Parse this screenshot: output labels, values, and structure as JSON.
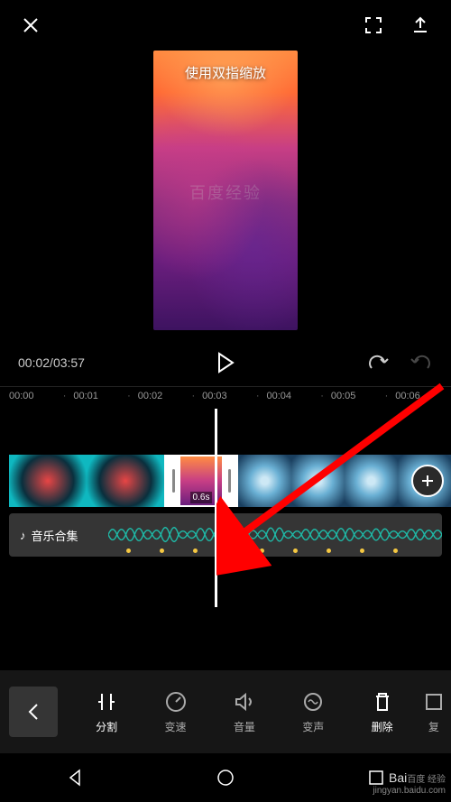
{
  "preview": {
    "hint": "使用双指缩放"
  },
  "playback": {
    "current_time": "00:02",
    "total_time": "03:57"
  },
  "ruler": {
    "marks": [
      "00:00",
      "00:01",
      "00:02",
      "00:03",
      "00:04",
      "00:05",
      "00:06"
    ]
  },
  "timeline": {
    "selected_clip_duration": "0.6s",
    "audio_track_label": "音乐合集"
  },
  "toolbar": {
    "split": "分割",
    "speed": "变速",
    "volume": "音量",
    "voice": "变声",
    "delete": "删除",
    "restore": "复"
  },
  "watermark": {
    "brand": "Bai",
    "brand_suffix": "百度",
    "sub": "经验",
    "url": "jingyan.baidu.com"
  }
}
